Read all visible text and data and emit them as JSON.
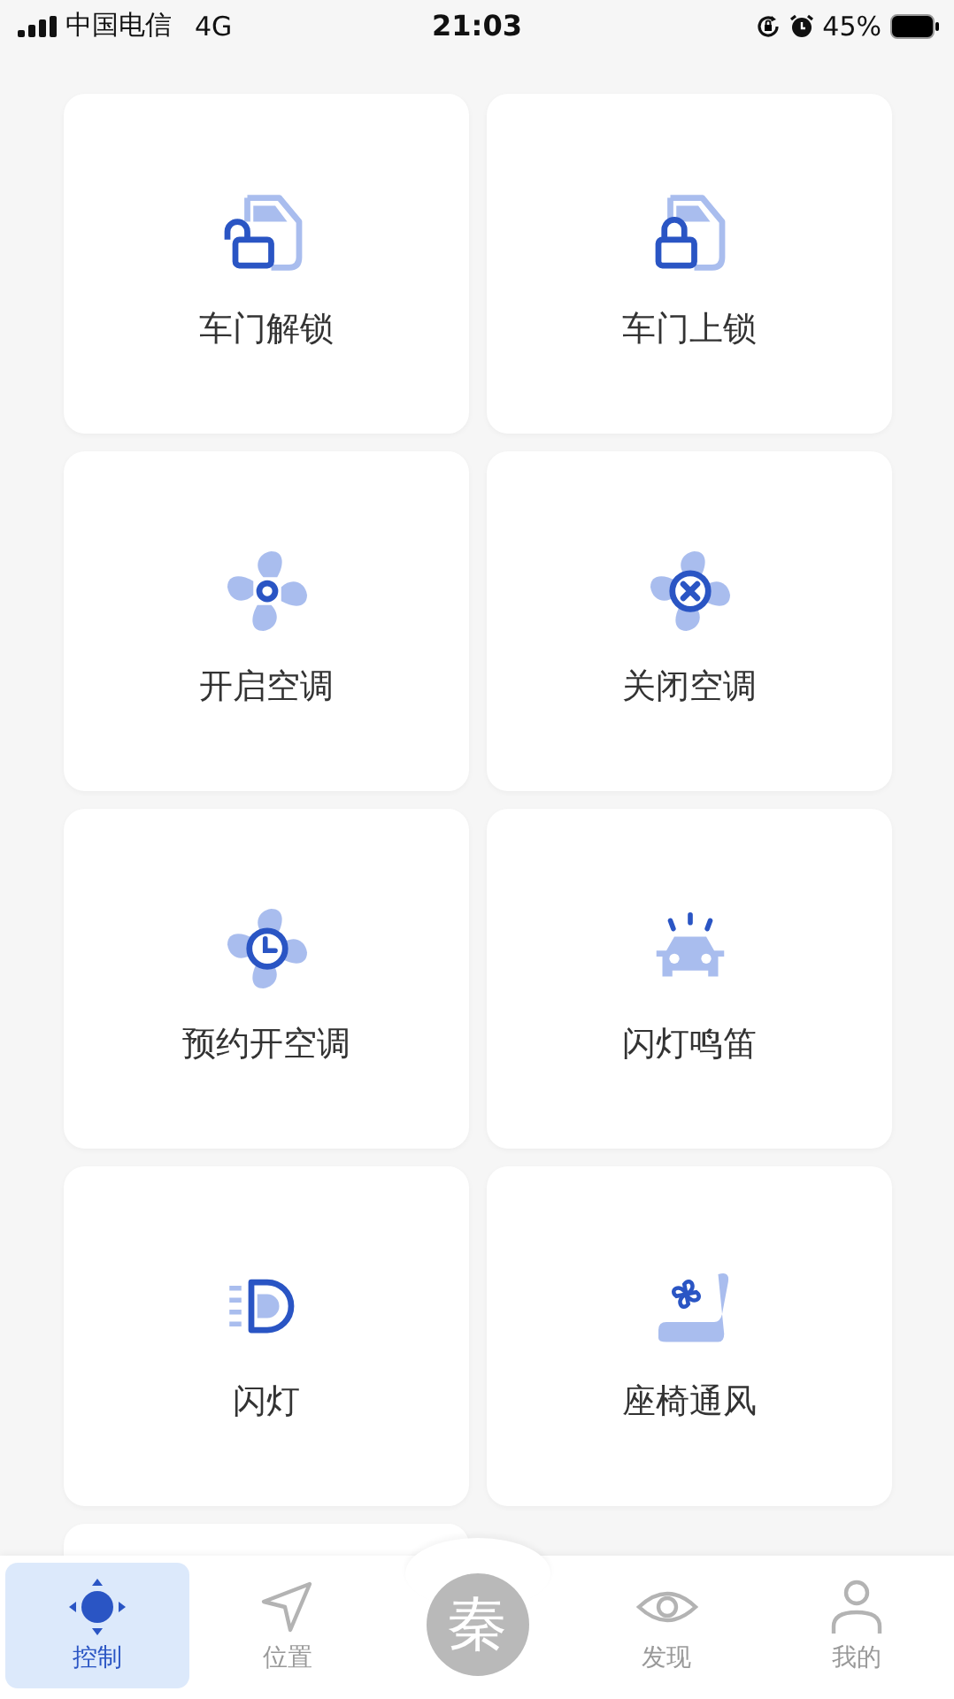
{
  "status_bar": {
    "carrier": "中国电信",
    "network": "4G",
    "time": "21:03",
    "battery": "45%"
  },
  "cards": [
    {
      "label": "车门解锁"
    },
    {
      "label": "车门上锁"
    },
    {
      "label": "开启空调"
    },
    {
      "label": "关闭空调"
    },
    {
      "label": "预约开空调"
    },
    {
      "label": "闪灯鸣笛"
    },
    {
      "label": "闪灯"
    },
    {
      "label": "座椅通风"
    }
  ],
  "tab_bar": [
    {
      "kind": "tab",
      "label": "控制",
      "selected": true
    },
    {
      "kind": "tab",
      "label": "位置",
      "selected": false
    },
    {
      "kind": "logo",
      "label": "秦"
    },
    {
      "kind": "tab",
      "label": "发现",
      "selected": false
    },
    {
      "kind": "tab",
      "label": "我的",
      "selected": false
    }
  ]
}
